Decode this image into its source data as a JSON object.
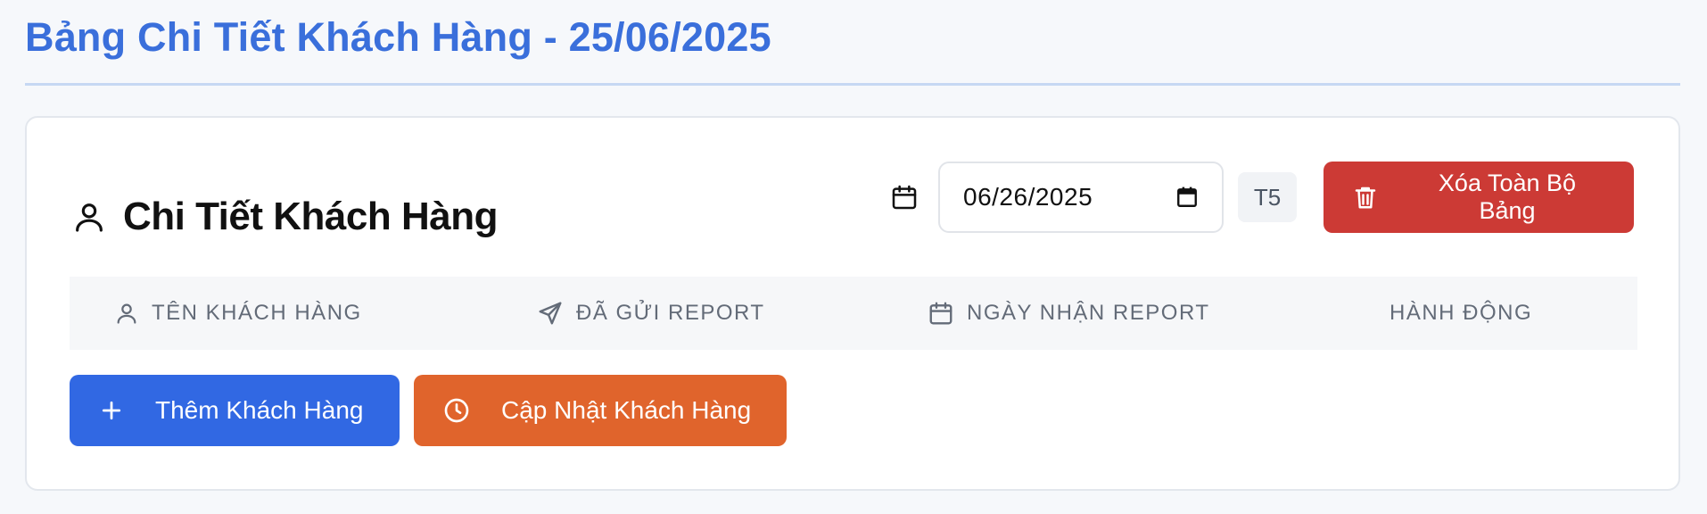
{
  "page": {
    "title": "Bảng Chi Tiết Khách Hàng - 25/06/2025"
  },
  "section": {
    "title": "Chi Tiết Khách Hàng",
    "icon": "user-icon"
  },
  "controls": {
    "date_value": "06/26/2025",
    "weekday": "T5",
    "delete_label": "Xóa Toàn Bộ Bảng",
    "calendar_icon": "calendar-icon",
    "delete_icon": "trash-icon"
  },
  "table": {
    "columns": [
      {
        "label": "TÊN KHÁCH HÀNG",
        "icon": "user-icon"
      },
      {
        "label": "ĐÃ GỬI REPORT",
        "icon": "send-icon"
      },
      {
        "label": "NGÀY NHẬN REPORT",
        "icon": "calendar-icon"
      },
      {
        "label": "HÀNH ĐỘNG",
        "icon": ""
      }
    ]
  },
  "actions": {
    "add_label": "Thêm Khách Hàng",
    "add_icon": "plus-icon",
    "update_label": "Cập Nhật Khách Hàng",
    "update_icon": "clock-icon"
  },
  "colors": {
    "title": "#3a6fdb",
    "delete": "#cc3a35",
    "add": "#3168e3",
    "update": "#e0642c"
  }
}
